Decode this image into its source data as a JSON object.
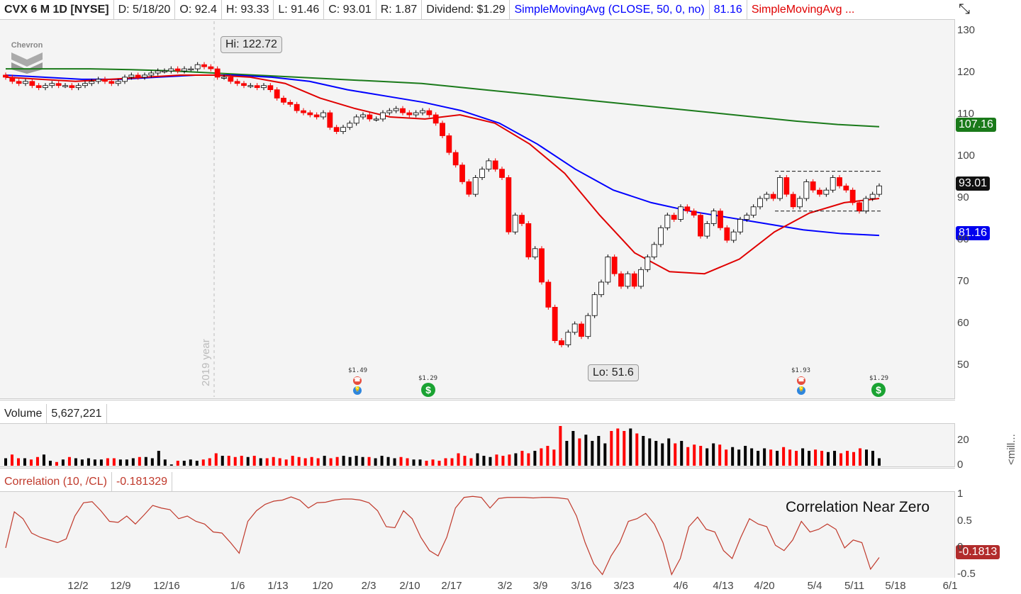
{
  "header": {
    "symbol": "CVX 6 M 1D [NYSE]",
    "date": "D: 5/18/20",
    "open": "O: 92.4",
    "high": "H: 93.33",
    "low": "L: 91.46",
    "close": "C: 93.01",
    "range": "R: 1.87",
    "dividend": "Dividend: $1.29",
    "sma50_label": "SimpleMovingAvg (CLOSE, 50, 0, no)",
    "sma50_value": "81.16",
    "sma20_label": "SimpleMovingAvg ..."
  },
  "logo": "Chevron",
  "annotations": {
    "hi": "Hi: 122.72",
    "lo": "Lo: 51.6",
    "year": "2019 year",
    "dividends": [
      {
        "amount": "$1.49",
        "type": "dividend-announcement"
      },
      {
        "amount": "$1.29",
        "type": "dividend"
      },
      {
        "amount": "$1.93",
        "type": "dividend-announcement"
      },
      {
        "amount": "$1.29",
        "type": "dividend"
      }
    ]
  },
  "price_tags": {
    "sma200": "107.16",
    "last": "93.01",
    "sma50": "81.16"
  },
  "colors": {
    "sma200": "#1a7a1a",
    "sma50": "#0000ff",
    "sma20": "#e00000",
    "up": "#000000",
    "down": "#ff0000",
    "corr": "#c0392b"
  },
  "volume": {
    "label": "Volume",
    "value": "5,627,221",
    "unit": "<mill..."
  },
  "correlation": {
    "label": "Correlation (10, /CL)",
    "value": "-0.181329",
    "tag": "-0.1813",
    "note": "Correlation Near Zero"
  },
  "chart_data": {
    "type": "candlestick",
    "price_axis": {
      "ticks": [
        "130",
        "120",
        "110",
        "100",
        "90",
        "80",
        "70",
        "60",
        "50"
      ],
      "range": [
        42,
        132
      ]
    },
    "x_ticks": [
      "12/2",
      "12/9",
      "12/16",
      "1/6",
      "1/13",
      "1/20",
      "2/3",
      "2/10",
      "2/17",
      "3/2",
      "3/9",
      "3/16",
      "3/23",
      "4/6",
      "4/13",
      "4/20",
      "5/4",
      "5/11",
      "5/18",
      "6/1"
    ],
    "closes": [
      119,
      118,
      117.5,
      118,
      117,
      116.5,
      117,
      117.5,
      117,
      117,
      116.5,
      117,
      117.5,
      118,
      118.5,
      118,
      117.5,
      118,
      119,
      119.5,
      119,
      119.5,
      120,
      120.5,
      120.5,
      121,
      120.5,
      121,
      121,
      122,
      121.5,
      121,
      119,
      119,
      118,
      117.5,
      117,
      117,
      116.5,
      117,
      116,
      114,
      113,
      112.5,
      111,
      110.5,
      110,
      109.5,
      110.5,
      107,
      106,
      107,
      108,
      109.5,
      110,
      109,
      109,
      110.5,
      111,
      111.5,
      110.5,
      110,
      110.5,
      111,
      110,
      108,
      105,
      101,
      98,
      94,
      91,
      95,
      97,
      99,
      97,
      95,
      82,
      86,
      84,
      76,
      78,
      70,
      64,
      56,
      55,
      58,
      60,
      57,
      62,
      67,
      70,
      76,
      72,
      69,
      72,
      69,
      73,
      76,
      79,
      83,
      86,
      85,
      88,
      87,
      86,
      81,
      84,
      87,
      83,
      80,
      82,
      85,
      86,
      88,
      90,
      91,
      90,
      95,
      91,
      88,
      90,
      94,
      92,
      91,
      92,
      95,
      93,
      92,
      89,
      87,
      90,
      91,
      93.01
    ],
    "sma200": [
      121,
      121,
      121,
      120.8,
      120.5,
      120,
      119.5,
      119,
      118.5,
      118,
      117.5,
      116.5,
      115.5,
      114.5,
      113.5,
      112.5,
      111.5,
      110.5,
      109.5,
      108.5,
      107.7,
      107.16
    ],
    "sma50": [
      119.5,
      119,
      118.5,
      118.5,
      119,
      119.5,
      119.5,
      119,
      118,
      116,
      114.5,
      113,
      111,
      108,
      103,
      97,
      92,
      89,
      87,
      85.5,
      84,
      82.5,
      81.6,
      81.16
    ],
    "sma20": [
      119,
      118.5,
      118,
      118.5,
      119,
      119.5,
      119.5,
      119,
      117.5,
      114,
      111.5,
      109.5,
      109,
      110,
      108,
      103,
      96,
      86,
      77,
      72.5,
      72,
      75.5,
      82,
      86.5,
      89,
      90
    ],
    "volume": {
      "axis": [
        "20",
        "0"
      ],
      "values": [
        6,
        9,
        6,
        6,
        5,
        7,
        9,
        4,
        3,
        5,
        7,
        6,
        5,
        6,
        5,
        5,
        6,
        6,
        5,
        5,
        6,
        7,
        7,
        6,
        12,
        5,
        1,
        4,
        4,
        5,
        4,
        5,
        6,
        10,
        8,
        8,
        7,
        8,
        7,
        8,
        6,
        6,
        7,
        6,
        5,
        8,
        7,
        6,
        7,
        6,
        8,
        6,
        7,
        8,
        7,
        8,
        7,
        7,
        6,
        8,
        7,
        6,
        7,
        6,
        5,
        5,
        4,
        5,
        4,
        6,
        6,
        10,
        8,
        6,
        10,
        8,
        7,
        9,
        8,
        9,
        10,
        12,
        10,
        12,
        14,
        16,
        13,
        32,
        20,
        28,
        22,
        25,
        20,
        24,
        18,
        28,
        30,
        28,
        30,
        26,
        24,
        22,
        20,
        18,
        22,
        18,
        20,
        15,
        17,
        16,
        14,
        18,
        17,
        13,
        15,
        13,
        16,
        14,
        12,
        14,
        13,
        12,
        15,
        13,
        12,
        14,
        12,
        13,
        12,
        11,
        12,
        10,
        12,
        11,
        14,
        13,
        12,
        6
      ]
    },
    "correlation": {
      "axis": [
        "1",
        "0.5",
        "0",
        "-0.5"
      ],
      "values": [
        0,
        0.68,
        0.55,
        0.28,
        0.2,
        0.15,
        0.1,
        0.17,
        0.6,
        0.85,
        0.87,
        0.7,
        0.5,
        0.48,
        0.6,
        0.45,
        0.62,
        0.8,
        0.75,
        0.72,
        0.55,
        0.6,
        0.5,
        0.45,
        0.3,
        0.28,
        0.1,
        -0.1,
        0.5,
        0.7,
        0.82,
        0.88,
        0.9,
        0.96,
        0.9,
        0.75,
        0.85,
        0.86,
        0.9,
        0.92,
        0.92,
        0.9,
        0.85,
        0.7,
        0.4,
        0.38,
        0.7,
        0.55,
        0.2,
        -0.05,
        -0.15,
        0.2,
        0.75,
        0.95,
        0.97,
        0.95,
        0.75,
        0.93,
        0.95,
        0.95,
        0.95,
        0.94,
        0.95,
        0.95,
        0.94,
        0.92,
        0.6,
        0.1,
        -0.3,
        -0.5,
        -0.15,
        0.1,
        0.5,
        0.55,
        0.65,
        0.45,
        0.1,
        -0.5,
        -0.2,
        0.4,
        0.58,
        0.35,
        0.3,
        -0.05,
        -0.2,
        0.2,
        0.55,
        0.45,
        0.4,
        0.05,
        -0.05,
        0.15,
        0.5,
        0.3,
        0.35,
        0.45,
        0.35,
        0,
        0.15,
        0.1,
        -0.4,
        -0.18
      ]
    },
    "consolidation_lines": [
      96.5,
      87
    ]
  }
}
